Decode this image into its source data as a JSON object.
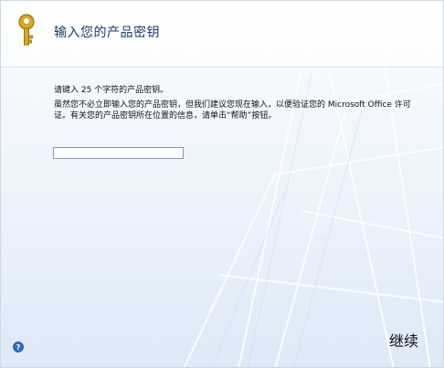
{
  "dialog": {
    "title": "输入您的产品密钥",
    "instruction": "请键入 25 个字符的产品密钥。",
    "explanation": "虽然您不必立即输入您的产品密钥，但我们建议您现在输入，以便验证您的 Microsoft Office 许可证。有关您的产品密钥所在位置的信息，请单击“帮助”按钮。",
    "product_key_value": "",
    "next_label": "继续"
  },
  "icons": {
    "header": "key-icon",
    "help": "help-icon"
  },
  "colors": {
    "title": "#1f3a6b",
    "background": "#eaf2fb"
  }
}
